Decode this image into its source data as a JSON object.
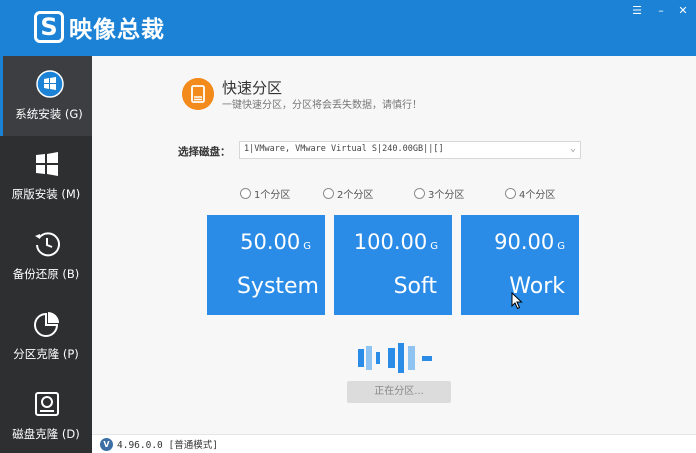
{
  "app": {
    "title": "映像总裁",
    "logo_letter": "S",
    "window_controls": [
      "☰",
      "–",
      "✕"
    ]
  },
  "sidebar": {
    "items": [
      {
        "label": "系统安装 (G)",
        "icon": "windows-logo-icon",
        "active": true
      },
      {
        "label": "原版安装 (M)",
        "icon": "windows-tiles-icon",
        "active": false
      },
      {
        "label": "备份还原 (B)",
        "icon": "clock-restore-icon",
        "active": false
      },
      {
        "label": "分区克隆 (P)",
        "icon": "pie-chart-icon",
        "active": false
      },
      {
        "label": "磁盘克隆 (D)",
        "icon": "disk-icon",
        "active": false
      }
    ]
  },
  "header": {
    "title": "快速分区",
    "subtitle": "一键快速分区，分区将会丢失数据，请慎行！"
  },
  "disk_select": {
    "label": "选择磁盘：",
    "value": "1|VMware,  VMware Virtual S|240.00GB||[]"
  },
  "partition_options": [
    {
      "label": "1个分区",
      "checked": false
    },
    {
      "label": "2个分区",
      "checked": false
    },
    {
      "label": "3个分区",
      "checked": false
    },
    {
      "label": "4个分区",
      "checked": false
    }
  ],
  "partitions": [
    {
      "size": "50.00",
      "unit": "G",
      "name": "System"
    },
    {
      "size": "100.00",
      "unit": "G",
      "name": "Soft"
    },
    {
      "size": "90.00",
      "unit": "G",
      "name": "Work"
    }
  ],
  "progress": {
    "button_label": "正在分区..."
  },
  "status": {
    "badge": "V",
    "version": "4.96.0.0 [普通模式]"
  },
  "colors": {
    "titlebar": "#1b82d6",
    "sidebar": "#2e2f31",
    "card": "#2b8ce8",
    "header_icon": "#f38a1c"
  }
}
